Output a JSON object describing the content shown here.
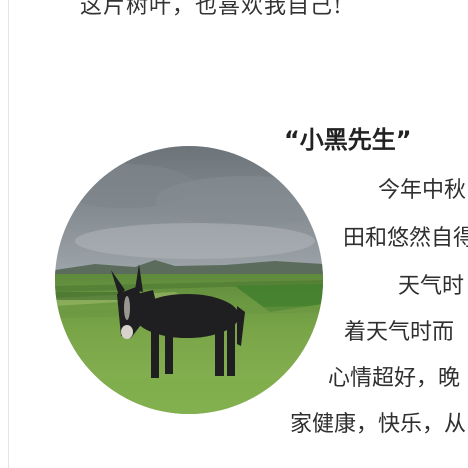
{
  "article": {
    "top_line": "这片树叶，也喜欢我自己!",
    "heading": "“小黑先生”",
    "lines": [
      "今年中秋",
      "田和悠然自得",
      "天气时",
      "着天气时而",
      "心情超好，晚",
      "家健康，快乐，从"
    ]
  },
  "photo": {
    "subject": "donkey-in-field",
    "colors": {
      "sky": "#8e969c",
      "grass": "#6f9a42",
      "donkey": "#1f1f22"
    }
  }
}
